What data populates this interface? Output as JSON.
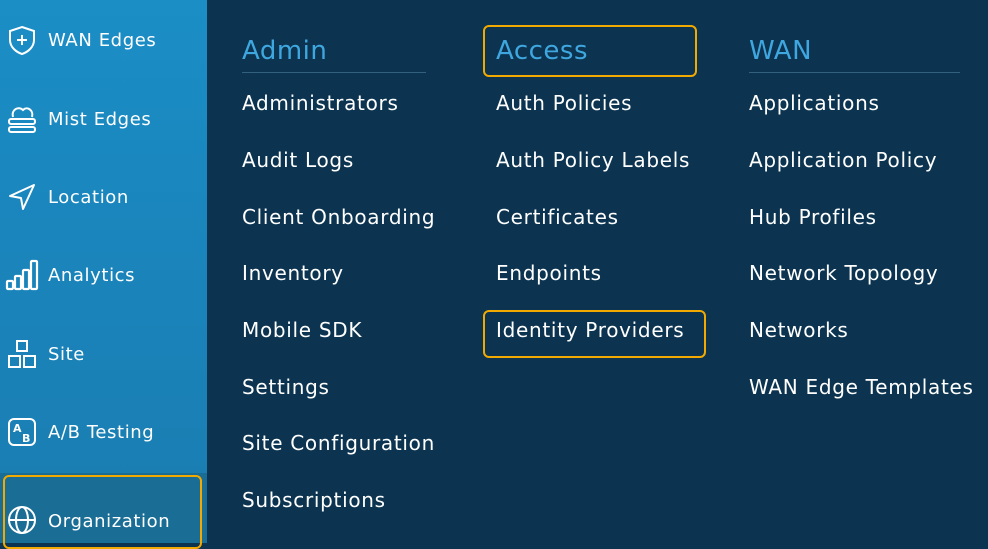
{
  "sidebar": {
    "items": [
      {
        "label": "WAN Edges",
        "icon": "plus-shield-icon"
      },
      {
        "label": "Mist Edges",
        "icon": "mist-edge-icon"
      },
      {
        "label": "Location",
        "icon": "location-arrow-icon"
      },
      {
        "label": "Analytics",
        "icon": "analytics-bars-icon"
      },
      {
        "label": "Site",
        "icon": "site-blocks-icon"
      },
      {
        "label": "A/B Testing",
        "icon": "ab-testing-icon"
      },
      {
        "label": "Organization",
        "icon": "globe-icon",
        "active": true
      }
    ]
  },
  "menu": {
    "admin": {
      "title": "Admin",
      "links": [
        "Administrators",
        "Audit Logs",
        "Client Onboarding",
        "Inventory",
        "Mobile SDK",
        "Settings",
        "Site Configuration",
        "Subscriptions"
      ]
    },
    "access": {
      "title": "Access",
      "links": [
        "Auth Policies",
        "Auth Policy Labels",
        "Certificates",
        "Endpoints",
        "Identity Providers"
      ]
    },
    "wan": {
      "title": "WAN",
      "links": [
        "Applications",
        "Application Policy",
        "Hub Profiles",
        "Network Topology",
        "Networks",
        "WAN Edge Templates"
      ]
    }
  },
  "colors": {
    "sidebar_bg": "#1b8ec6",
    "menu_bg": "#0c3450",
    "title_color": "#3fa7df",
    "highlight": "#f2a900"
  }
}
